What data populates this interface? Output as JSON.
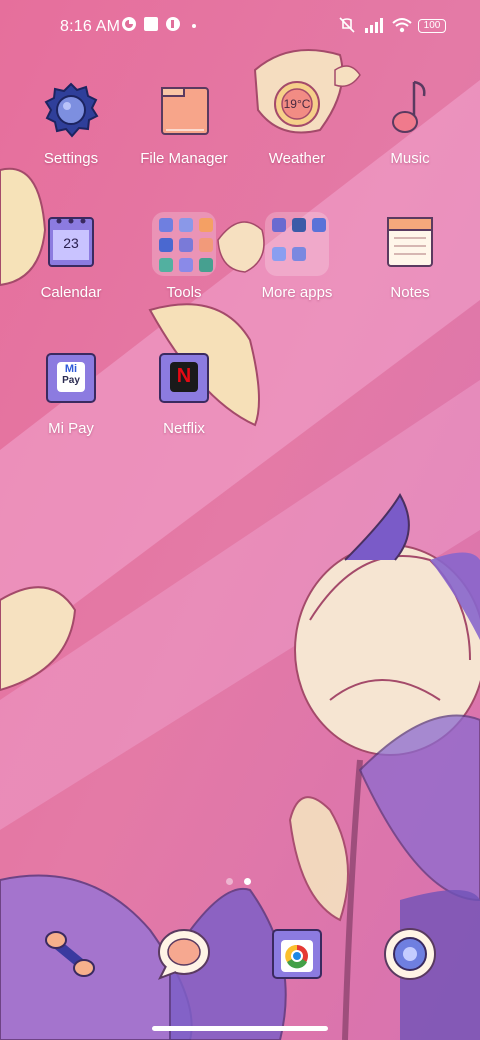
{
  "status_bar": {
    "time": "8:16 AM",
    "battery": "100",
    "icons": [
      "notification-c-icon",
      "square-notification-icon",
      "notification-d-icon",
      "dot-icon",
      "mute-icon",
      "signal-icon",
      "wifi-icon",
      "battery-icon"
    ]
  },
  "home": {
    "apps": [
      {
        "label": "Settings",
        "icon": "gear-icon"
      },
      {
        "label": "File Manager",
        "icon": "folder-icon"
      },
      {
        "label": "Weather",
        "icon": "weather-icon",
        "temperature": "19°C"
      },
      {
        "label": "Music",
        "icon": "music-note-icon"
      },
      {
        "label": "Calendar",
        "icon": "calendar-icon",
        "date": "23"
      },
      {
        "label": "Tools",
        "icon": "folder-icon"
      },
      {
        "label": "More apps",
        "icon": "folder-icon"
      },
      {
        "label": "Notes",
        "icon": "notes-icon"
      },
      {
        "label": "Mi Pay",
        "icon": "mi-pay-icon",
        "badge_top": "Mi",
        "badge_bottom": "Pay"
      },
      {
        "label": "Netflix",
        "icon": "netflix-icon",
        "badge": "N"
      }
    ]
  },
  "page_indicator": {
    "pages": 2,
    "current": 2
  },
  "dock": [
    {
      "name": "phone",
      "icon": "phone-icon"
    },
    {
      "name": "messages",
      "icon": "message-bubble-icon"
    },
    {
      "name": "chrome",
      "icon": "chrome-icon"
    },
    {
      "name": "camera",
      "icon": "camera-lens-icon"
    }
  ],
  "colors": {
    "wallpaper_pink": "#e06f9a",
    "wallpaper_light": "#f2a0c8",
    "accent_purple": "#7b6ad8",
    "peach": "#f4b28c",
    "cream": "#f6e9c8",
    "outline": "#5a3a60"
  }
}
